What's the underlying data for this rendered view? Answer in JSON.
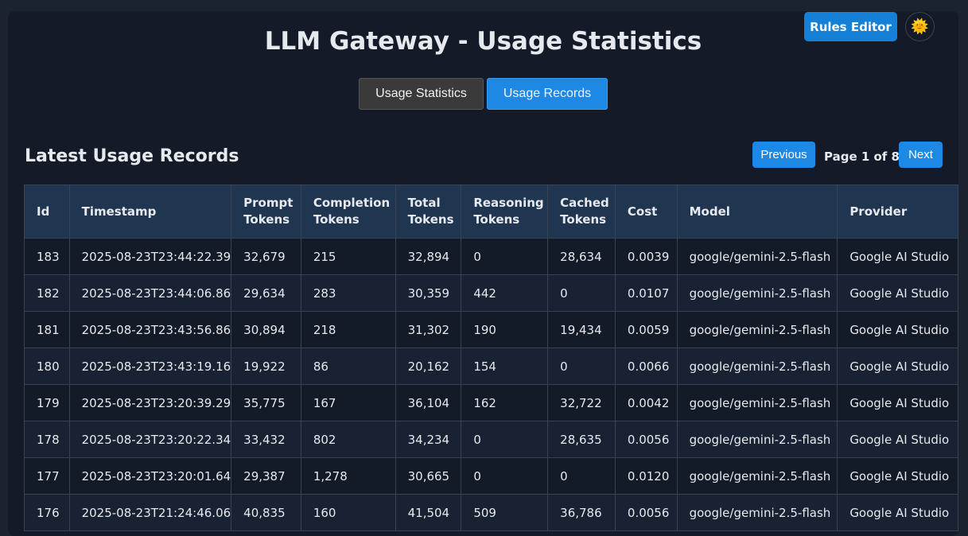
{
  "header": {
    "title": "LLM Gateway - Usage Statistics",
    "rules_editor_label": "Rules Editor",
    "theme_toggle_glyph": "🌞"
  },
  "tabs": [
    {
      "label": "Usage Statistics",
      "active": false
    },
    {
      "label": "Usage Records",
      "active": true
    }
  ],
  "section": {
    "title": "Latest Usage Records"
  },
  "pagination": {
    "previous_label": "Previous",
    "page_info": "Page 1 of 8",
    "next_label": "Next"
  },
  "table": {
    "columns": [
      [
        "Id"
      ],
      [
        "Timestamp"
      ],
      [
        "Prompt",
        "Tokens"
      ],
      [
        "Completion",
        "Tokens"
      ],
      [
        "Total",
        "Tokens"
      ],
      [
        "Reasoning",
        "Tokens"
      ],
      [
        "Cached",
        "Tokens"
      ],
      [
        "Cost"
      ],
      [
        "Model"
      ],
      [
        "Provider"
      ]
    ],
    "rows": [
      [
        "183",
        "2025-08-23T23:44:22.39",
        "32,679",
        "215",
        "32,894",
        "0",
        "28,634",
        "0.0039",
        "google/gemini-2.5-flash",
        "Google AI Studio"
      ],
      [
        "182",
        "2025-08-23T23:44:06.86",
        "29,634",
        "283",
        "30,359",
        "442",
        "0",
        "0.0107",
        "google/gemini-2.5-flash",
        "Google AI Studio"
      ],
      [
        "181",
        "2025-08-23T23:43:56.86",
        "30,894",
        "218",
        "31,302",
        "190",
        "19,434",
        "0.0059",
        "google/gemini-2.5-flash",
        "Google AI Studio"
      ],
      [
        "180",
        "2025-08-23T23:43:19.16",
        "19,922",
        "86",
        "20,162",
        "154",
        "0",
        "0.0066",
        "google/gemini-2.5-flash",
        "Google AI Studio"
      ],
      [
        "179",
        "2025-08-23T23:20:39.29",
        "35,775",
        "167",
        "36,104",
        "162",
        "32,722",
        "0.0042",
        "google/gemini-2.5-flash",
        "Google AI Studio"
      ],
      [
        "178",
        "2025-08-23T23:20:22.34",
        "33,432",
        "802",
        "34,234",
        "0",
        "28,635",
        "0.0056",
        "google/gemini-2.5-flash",
        "Google AI Studio"
      ],
      [
        "177",
        "2025-08-23T23:20:01.64",
        "29,387",
        "1,278",
        "30,665",
        "0",
        "0",
        "0.0120",
        "google/gemini-2.5-flash",
        "Google AI Studio"
      ],
      [
        "176",
        "2025-08-23T21:24:46.06",
        "40,835",
        "160",
        "41,504",
        "509",
        "36,786",
        "0.0056",
        "google/gemini-2.5-flash",
        "Google AI Studio"
      ]
    ]
  }
}
